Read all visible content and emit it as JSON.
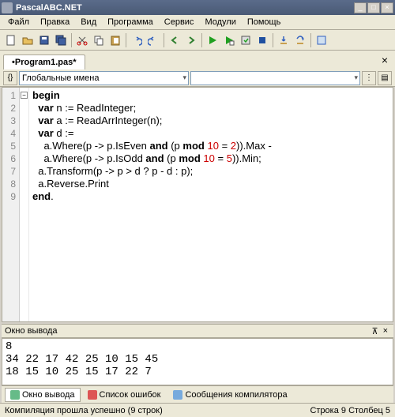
{
  "window": {
    "title": "PascalABC.NET"
  },
  "menu": {
    "items": [
      "Файл",
      "Правка",
      "Вид",
      "Программа",
      "Сервис",
      "Модули",
      "Помощь"
    ]
  },
  "docTab": {
    "label": "•Program1.pas*"
  },
  "nav": {
    "scope": "Глобальные имена"
  },
  "code": {
    "lineNumbers": [
      "1",
      "2",
      "3",
      "4",
      "5",
      "6",
      "7",
      "8",
      "9"
    ],
    "lines": [
      {
        "tokens": [
          {
            "t": "begin",
            "c": "kw"
          }
        ]
      },
      {
        "tokens": [
          {
            "t": "  "
          },
          {
            "t": "var",
            "c": "kw"
          },
          {
            "t": " n := ReadInteger;"
          }
        ]
      },
      {
        "tokens": [
          {
            "t": "  "
          },
          {
            "t": "var",
            "c": "kw"
          },
          {
            "t": " a := ReadArrInteger(n);"
          }
        ]
      },
      {
        "tokens": [
          {
            "t": "  "
          },
          {
            "t": "var",
            "c": "kw"
          },
          {
            "t": " d :="
          }
        ]
      },
      {
        "tokens": [
          {
            "t": "    a.Where(p -> p.IsEven "
          },
          {
            "t": "and",
            "c": "kw"
          },
          {
            "t": " (p "
          },
          {
            "t": "mod",
            "c": "kw"
          },
          {
            "t": " "
          },
          {
            "t": "10",
            "c": "num"
          },
          {
            "t": " = "
          },
          {
            "t": "2",
            "c": "num"
          },
          {
            "t": ")).Max -"
          }
        ]
      },
      {
        "tokens": [
          {
            "t": "    a.Where(p -> p.IsOdd "
          },
          {
            "t": "and",
            "c": "kw"
          },
          {
            "t": " (p "
          },
          {
            "t": "mod",
            "c": "kw"
          },
          {
            "t": " "
          },
          {
            "t": "10",
            "c": "num"
          },
          {
            "t": " = "
          },
          {
            "t": "5",
            "c": "num"
          },
          {
            "t": ")).Min;"
          }
        ]
      },
      {
        "tokens": [
          {
            "t": "  a.Transform(p -> p > d ? p - d : p);"
          }
        ]
      },
      {
        "tokens": [
          {
            "t": "  a.Reverse.Print"
          }
        ]
      },
      {
        "tokens": [
          {
            "t": "end",
            "c": "kw"
          },
          {
            "t": "."
          }
        ]
      }
    ]
  },
  "output": {
    "title": "Окно вывода",
    "text": "8\n34 22 17 42 25 10 15 45\n18 15 10 25 15 17 22 7"
  },
  "bottomTabs": [
    {
      "label": "Окно вывода",
      "icon": "#6b8",
      "active": true
    },
    {
      "label": "Список ошибок",
      "icon": "#d55",
      "active": false
    },
    {
      "label": "Сообщения компилятора",
      "icon": "#7ad",
      "active": false
    }
  ],
  "status": {
    "left": "Компиляция прошла успешно (9 строк)",
    "right": "Строка 9 Столбец 5"
  }
}
